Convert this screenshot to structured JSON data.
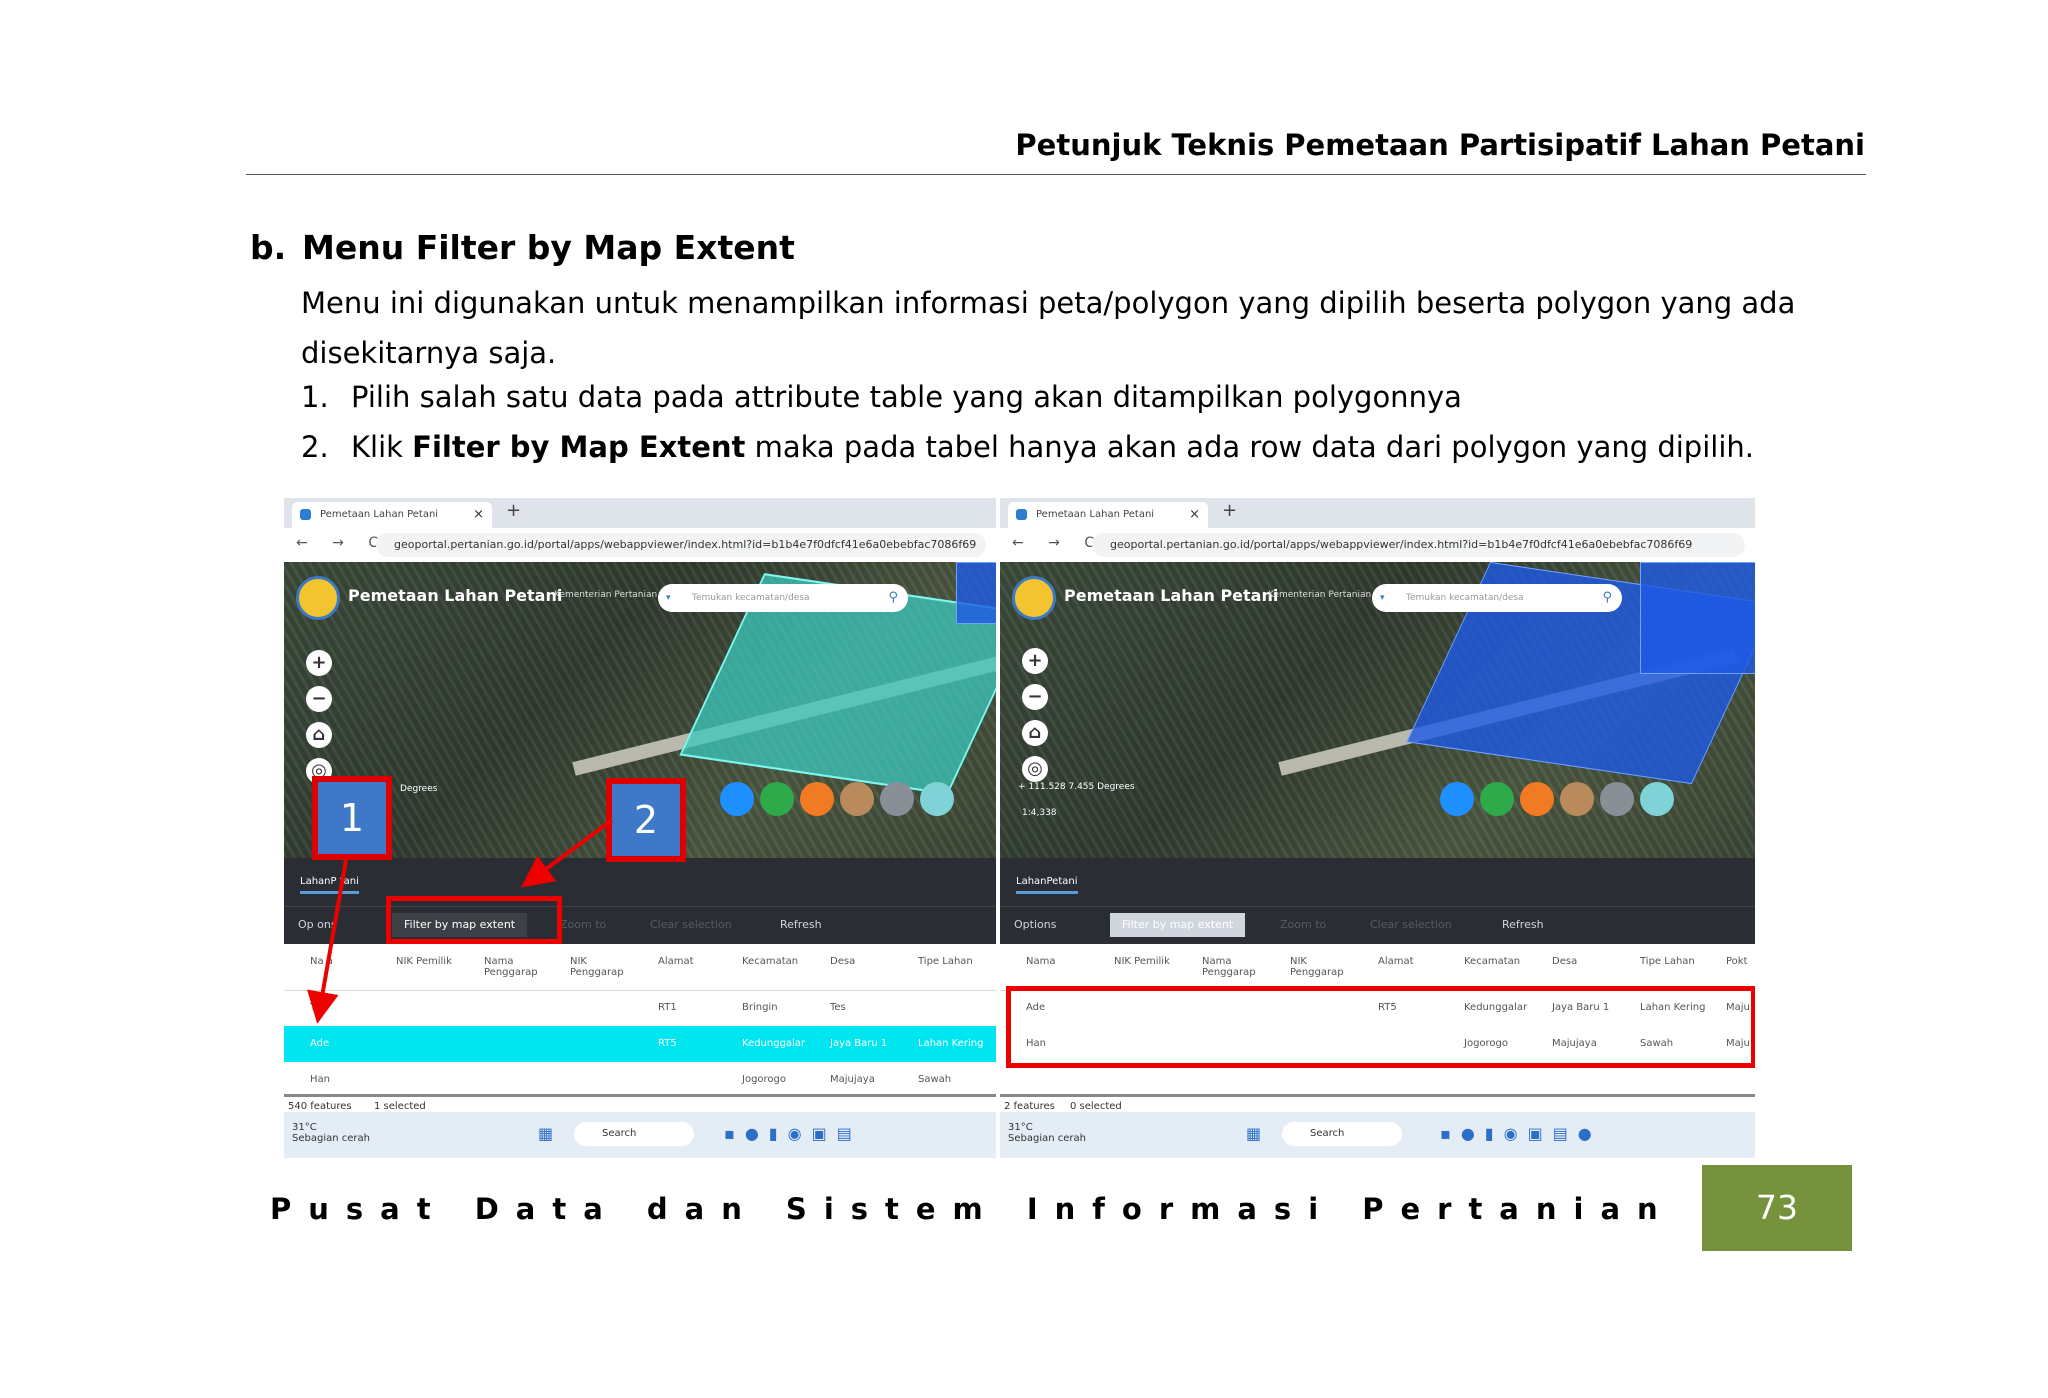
{
  "header": {
    "title": "Petunjuk Teknis Pemetaan Partisipatif Lahan Petani"
  },
  "section": {
    "letter": "b.",
    "title": "Menu Filter by Map Extent",
    "intro": "Menu ini digunakan untuk menampilkan informasi peta/polygon yang dipilih beserta polygon yang ada disekitarnya saja.",
    "steps": [
      {
        "num": "1.",
        "text": "Pilih salah satu data pada attribute table yang akan ditampilkan polygonnya"
      },
      {
        "num": "2.",
        "pre": "Klik ",
        "bold": "Filter by Map Extent",
        "post": " maka pada tabel hanya akan ada row data dari polygon yang dipilih."
      }
    ]
  },
  "browser": {
    "tab_title": "Pemetaan Lahan Petani",
    "tab_close": "×",
    "new_tab": "+",
    "nav": "← → C",
    "url": "geoportal.pertanian.go.id/portal/apps/webappviewer/index.html?id=b1b4e7f0dfcf41e6a0ebebfac7086f69"
  },
  "app": {
    "title": "Pemetaan Lahan Petani",
    "subtitle": "Kementerian Pertanian",
    "search_placeholder": "Temukan kecamatan/desa",
    "search_dropdown": "▾",
    "search_icon": "⚲",
    "zoom_in": "+",
    "zoom_out": "−",
    "home": "⌂",
    "locate": "◎",
    "layer_tab": "LahanPetani",
    "layer_tab_left": "LahanP   tani",
    "coords_left": "Degrees",
    "coords_right": "+ 111.528  7.455 Degrees",
    "scale_right": "1:4,338"
  },
  "toolbar": {
    "options": "Options",
    "options_left": "Op   ons",
    "filter": "Filter by map extent",
    "zoom": "Zoom to",
    "clear": "Clear selection",
    "refresh": "Refresh"
  },
  "table": {
    "headers": [
      "Nama",
      "NIK Pemilik",
      "Nama Penggarap",
      "NIK Penggarap",
      "Alamat",
      "Kecamatan",
      "Desa",
      "Tipe Lahan",
      "Pokt"
    ],
    "headers_left": [
      "Na    a",
      "NIK Pemilik",
      "Nama Penggarap",
      "NIK Penggarap",
      "Alamat",
      "Kecamatan",
      "Desa",
      "Tipe Lahan"
    ],
    "left_rows": [
      [
        "Tes",
        "",
        "",
        "",
        "RT1",
        "Bringin",
        "Tes",
        ""
      ],
      [
        "Ade",
        "",
        "",
        "",
        "RT5",
        "Kedunggalar",
        "Jaya Baru 1",
        "Lahan Kering"
      ],
      [
        "Han",
        "",
        "",
        "",
        "",
        "Jogorogo",
        "Majujaya",
        "Sawah"
      ]
    ],
    "right_rows": [
      [
        "Ade",
        "",
        "",
        "",
        "RT5",
        "Kedunggalar",
        "Jaya Baru 1",
        "Lahan Kering",
        "Maju"
      ],
      [
        "Han",
        "",
        "",
        "",
        "",
        "Jogorogo",
        "Majujaya",
        "Sawah",
        "Maju"
      ]
    ],
    "left_footer": {
      "features": "540 features",
      "selected": "1 selected"
    },
    "right_footer": {
      "features": "2 features",
      "selected": "0 selected"
    }
  },
  "taskbar": {
    "temp": "31°C",
    "weather": "Sebagian cerah",
    "search": "Search"
  },
  "callouts": {
    "one": "1",
    "two": "2"
  },
  "footer": {
    "org": "Pusat Data dan Sistem Informasi Pertanian",
    "page": "73"
  },
  "colors": {
    "accent_green": "#76923c",
    "callout_red": "#e00000",
    "callout_blue": "#3e78c7",
    "selected_row": "#00e6f0"
  }
}
